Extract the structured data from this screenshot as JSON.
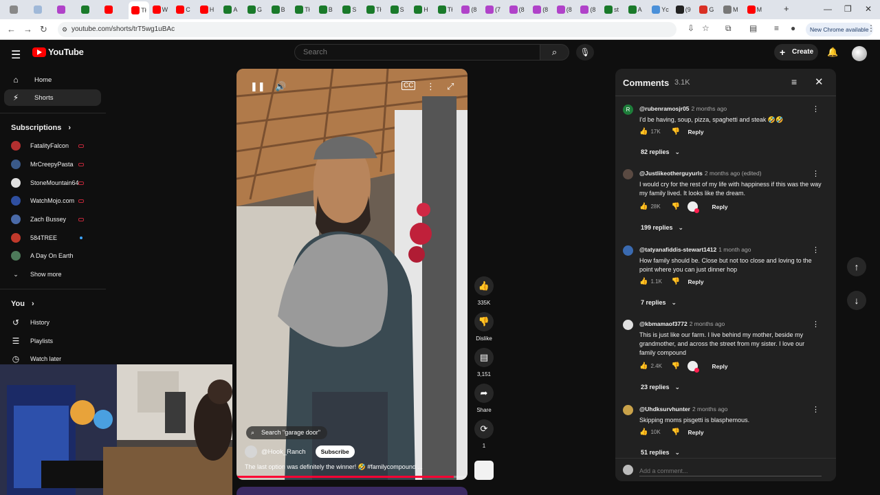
{
  "browser": {
    "url": "youtube.com/shorts/trT5wg1uBAc",
    "new_chrome": "New Chrome available",
    "tabs": [
      {
        "label": "",
        "color": "#888888"
      },
      {
        "label": "",
        "color": "#9fb8d8"
      },
      {
        "label": "",
        "color": "#b042c9"
      },
      {
        "label": "",
        "color": "#1a7a2a"
      },
      {
        "label": "",
        "color": "#ff0000"
      },
      {
        "label": "Tł",
        "color": "#ff0000"
      },
      {
        "label": "W",
        "color": "#ff0000"
      },
      {
        "label": "C",
        "color": "#ff0000"
      },
      {
        "label": "H",
        "color": "#ff0000"
      },
      {
        "label": "A",
        "color": "#1a7a2a"
      },
      {
        "label": "G",
        "color": "#1a7a2a"
      },
      {
        "label": "B",
        "color": "#1a7a2a"
      },
      {
        "label": "Tł",
        "color": "#1a7a2a"
      },
      {
        "label": "B",
        "color": "#1a7a2a"
      },
      {
        "label": "S",
        "color": "#1a7a2a"
      },
      {
        "label": "Tł",
        "color": "#1a7a2a"
      },
      {
        "label": "S",
        "color": "#1a7a2a"
      },
      {
        "label": "H",
        "color": "#1a7a2a"
      },
      {
        "label": "Tł",
        "color": "#1a7a2a"
      },
      {
        "label": "(8",
        "color": "#b042c9"
      },
      {
        "label": "(7",
        "color": "#b042c9"
      },
      {
        "label": "(8",
        "color": "#b042c9"
      },
      {
        "label": "(8",
        "color": "#b042c9"
      },
      {
        "label": "(8",
        "color": "#b042c9"
      },
      {
        "label": "(8",
        "color": "#b042c9"
      },
      {
        "label": "st",
        "color": "#1a7a2a"
      },
      {
        "label": "A",
        "color": "#1a7a2a"
      },
      {
        "label": "Yc",
        "color": "#4a90d9"
      },
      {
        "label": "(9",
        "color": "#222222"
      },
      {
        "label": "G",
        "color": "#d93025"
      },
      {
        "label": "M",
        "color": "#777777"
      },
      {
        "label": "M",
        "color": "#ff0000"
      }
    ]
  },
  "header": {
    "logo": "YouTube",
    "search_placeholder": "Search",
    "create_label": "Create"
  },
  "sidebar": {
    "main": [
      {
        "label": "Home",
        "icon": "home-icon"
      },
      {
        "label": "Shorts",
        "icon": "shorts-icon"
      }
    ],
    "subscriptions_title": "Subscriptions",
    "subscriptions": [
      {
        "name": "FatalityFalcon",
        "color": "#b33030",
        "live": true
      },
      {
        "name": "MrCreepyPasta",
        "color": "#3a5a8a",
        "live": true
      },
      {
        "name": "StoneMountain64",
        "color": "#e0e0e0",
        "live": true
      },
      {
        "name": "WatchMojo.com",
        "color": "#2f4fa0",
        "live": true
      },
      {
        "name": "Zach Bussey",
        "color": "#4a6aa8",
        "live": true
      },
      {
        "name": "584TREE",
        "color": "#c0392b",
        "live": false
      },
      {
        "name": "A Day On Earth",
        "color": "#4d7a5a",
        "live": false
      }
    ],
    "show_more": "Show more",
    "you_title": "You",
    "you_items": [
      {
        "label": "History",
        "icon": "history-icon"
      },
      {
        "label": "Playlists",
        "icon": "playlists-icon"
      },
      {
        "label": "Watch later",
        "icon": "clock-icon"
      }
    ]
  },
  "video": {
    "search_pill": "Search \"garage door\"",
    "channel": "@Hook_Ranch",
    "subscribe": "Subscribe",
    "caption": "The last option was definitely the winner! 🤣 #familycompound ...",
    "progress": 0.94
  },
  "actions": {
    "likes": "335K",
    "dislike": "Dislike",
    "comments": "3,151",
    "share": "Share",
    "remix": "1"
  },
  "comments_panel": {
    "title": "Comments",
    "count": "3.1K",
    "add_placeholder": "Add a comment...",
    "items": [
      {
        "handle": "@rubenramosjr05",
        "time": "2 months ago",
        "avatar_letter": "R",
        "avatar_color": "#1e7d3a",
        "text": "I'd be having, soup, pizza, spaghetti and steak 🤣🤣",
        "likes": "17K",
        "heart": false,
        "replies": "82 replies"
      },
      {
        "handle": "@Justlikeotherguyurls",
        "time": "2 months ago (edited)",
        "avatar_letter": "",
        "avatar_color": "#5a4a42",
        "text": "I would cry for the rest of my life with happiness if this was the way my family lived. It looks like the dream.",
        "likes": "28K",
        "heart": true,
        "replies": "199 replies"
      },
      {
        "handle": "@tatyanafiddis-stewart1412",
        "time": "1 month ago",
        "avatar_letter": "",
        "avatar_color": "#3a6ab0",
        "text": "How family should be. Close but not too close and loving to the point where you can just dinner hop",
        "likes": "1.1K",
        "heart": false,
        "replies": "7 replies"
      },
      {
        "handle": "@kbmamaof3772",
        "time": "2 months ago",
        "avatar_letter": "",
        "avatar_color": "#e0e0e0",
        "text": "This is just like our farm. I live behind my mother, beside my grandmother, and across the street from my sister. I love our family compound",
        "likes": "2.4K",
        "heart": true,
        "replies": "23 replies"
      },
      {
        "handle": "@Uhdksurvhunter",
        "time": "2 months ago",
        "avatar_letter": "",
        "avatar_color": "#c9a24a",
        "text": "Skipping moms pisgetti is blasphemous.",
        "likes": "10K",
        "heart": false,
        "replies": "51 replies"
      }
    ]
  }
}
